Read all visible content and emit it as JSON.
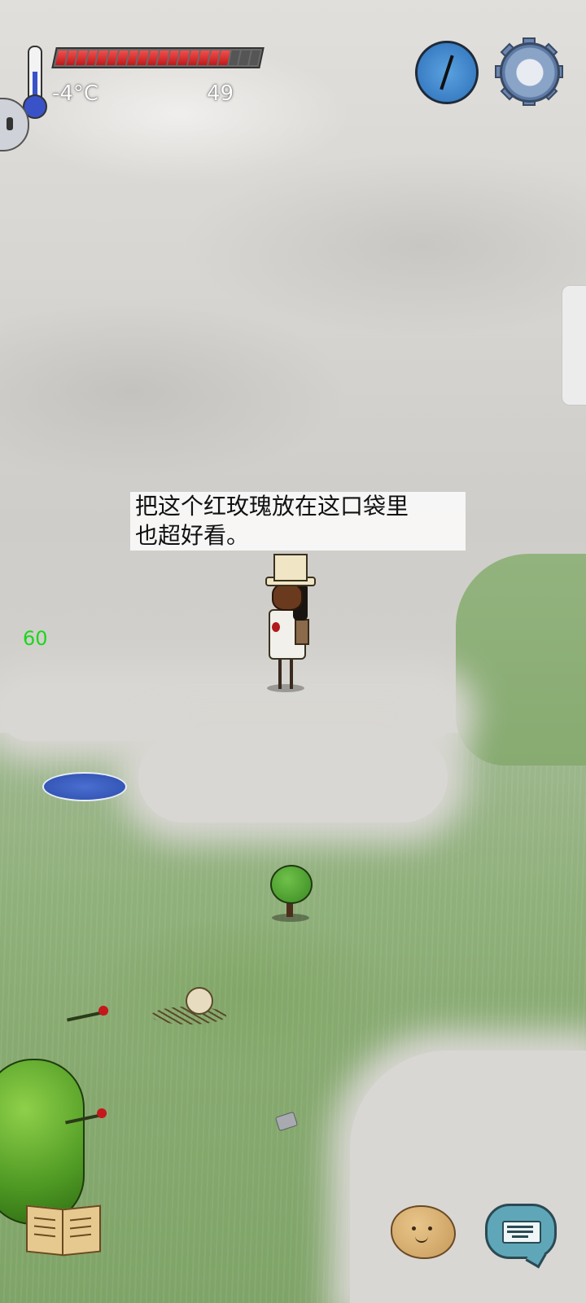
{
  "hud": {
    "temperature": "-4°C",
    "age": "49",
    "health_segments_total": 20,
    "health_segments_filled": 17,
    "thermometer_level": 0.45,
    "icons": [
      "thermometer-icon",
      "compass-icon",
      "settings-gear-icon",
      "tech-tree-book-icon",
      "emote-potato-icon",
      "keyboard-chat-icon",
      "side-menu-icon"
    ]
  },
  "speech": {
    "line1": "把这个红玫瑰放在这口袋里",
    "line2": "也超好看。"
  },
  "debug": {
    "fps": "60"
  },
  "colors": {
    "health_fill": "#e02c2c",
    "fps_text": "#1cd61c",
    "pond": "#3557b8",
    "grass": "#8fb07a",
    "fog": "#d9d7d3"
  }
}
